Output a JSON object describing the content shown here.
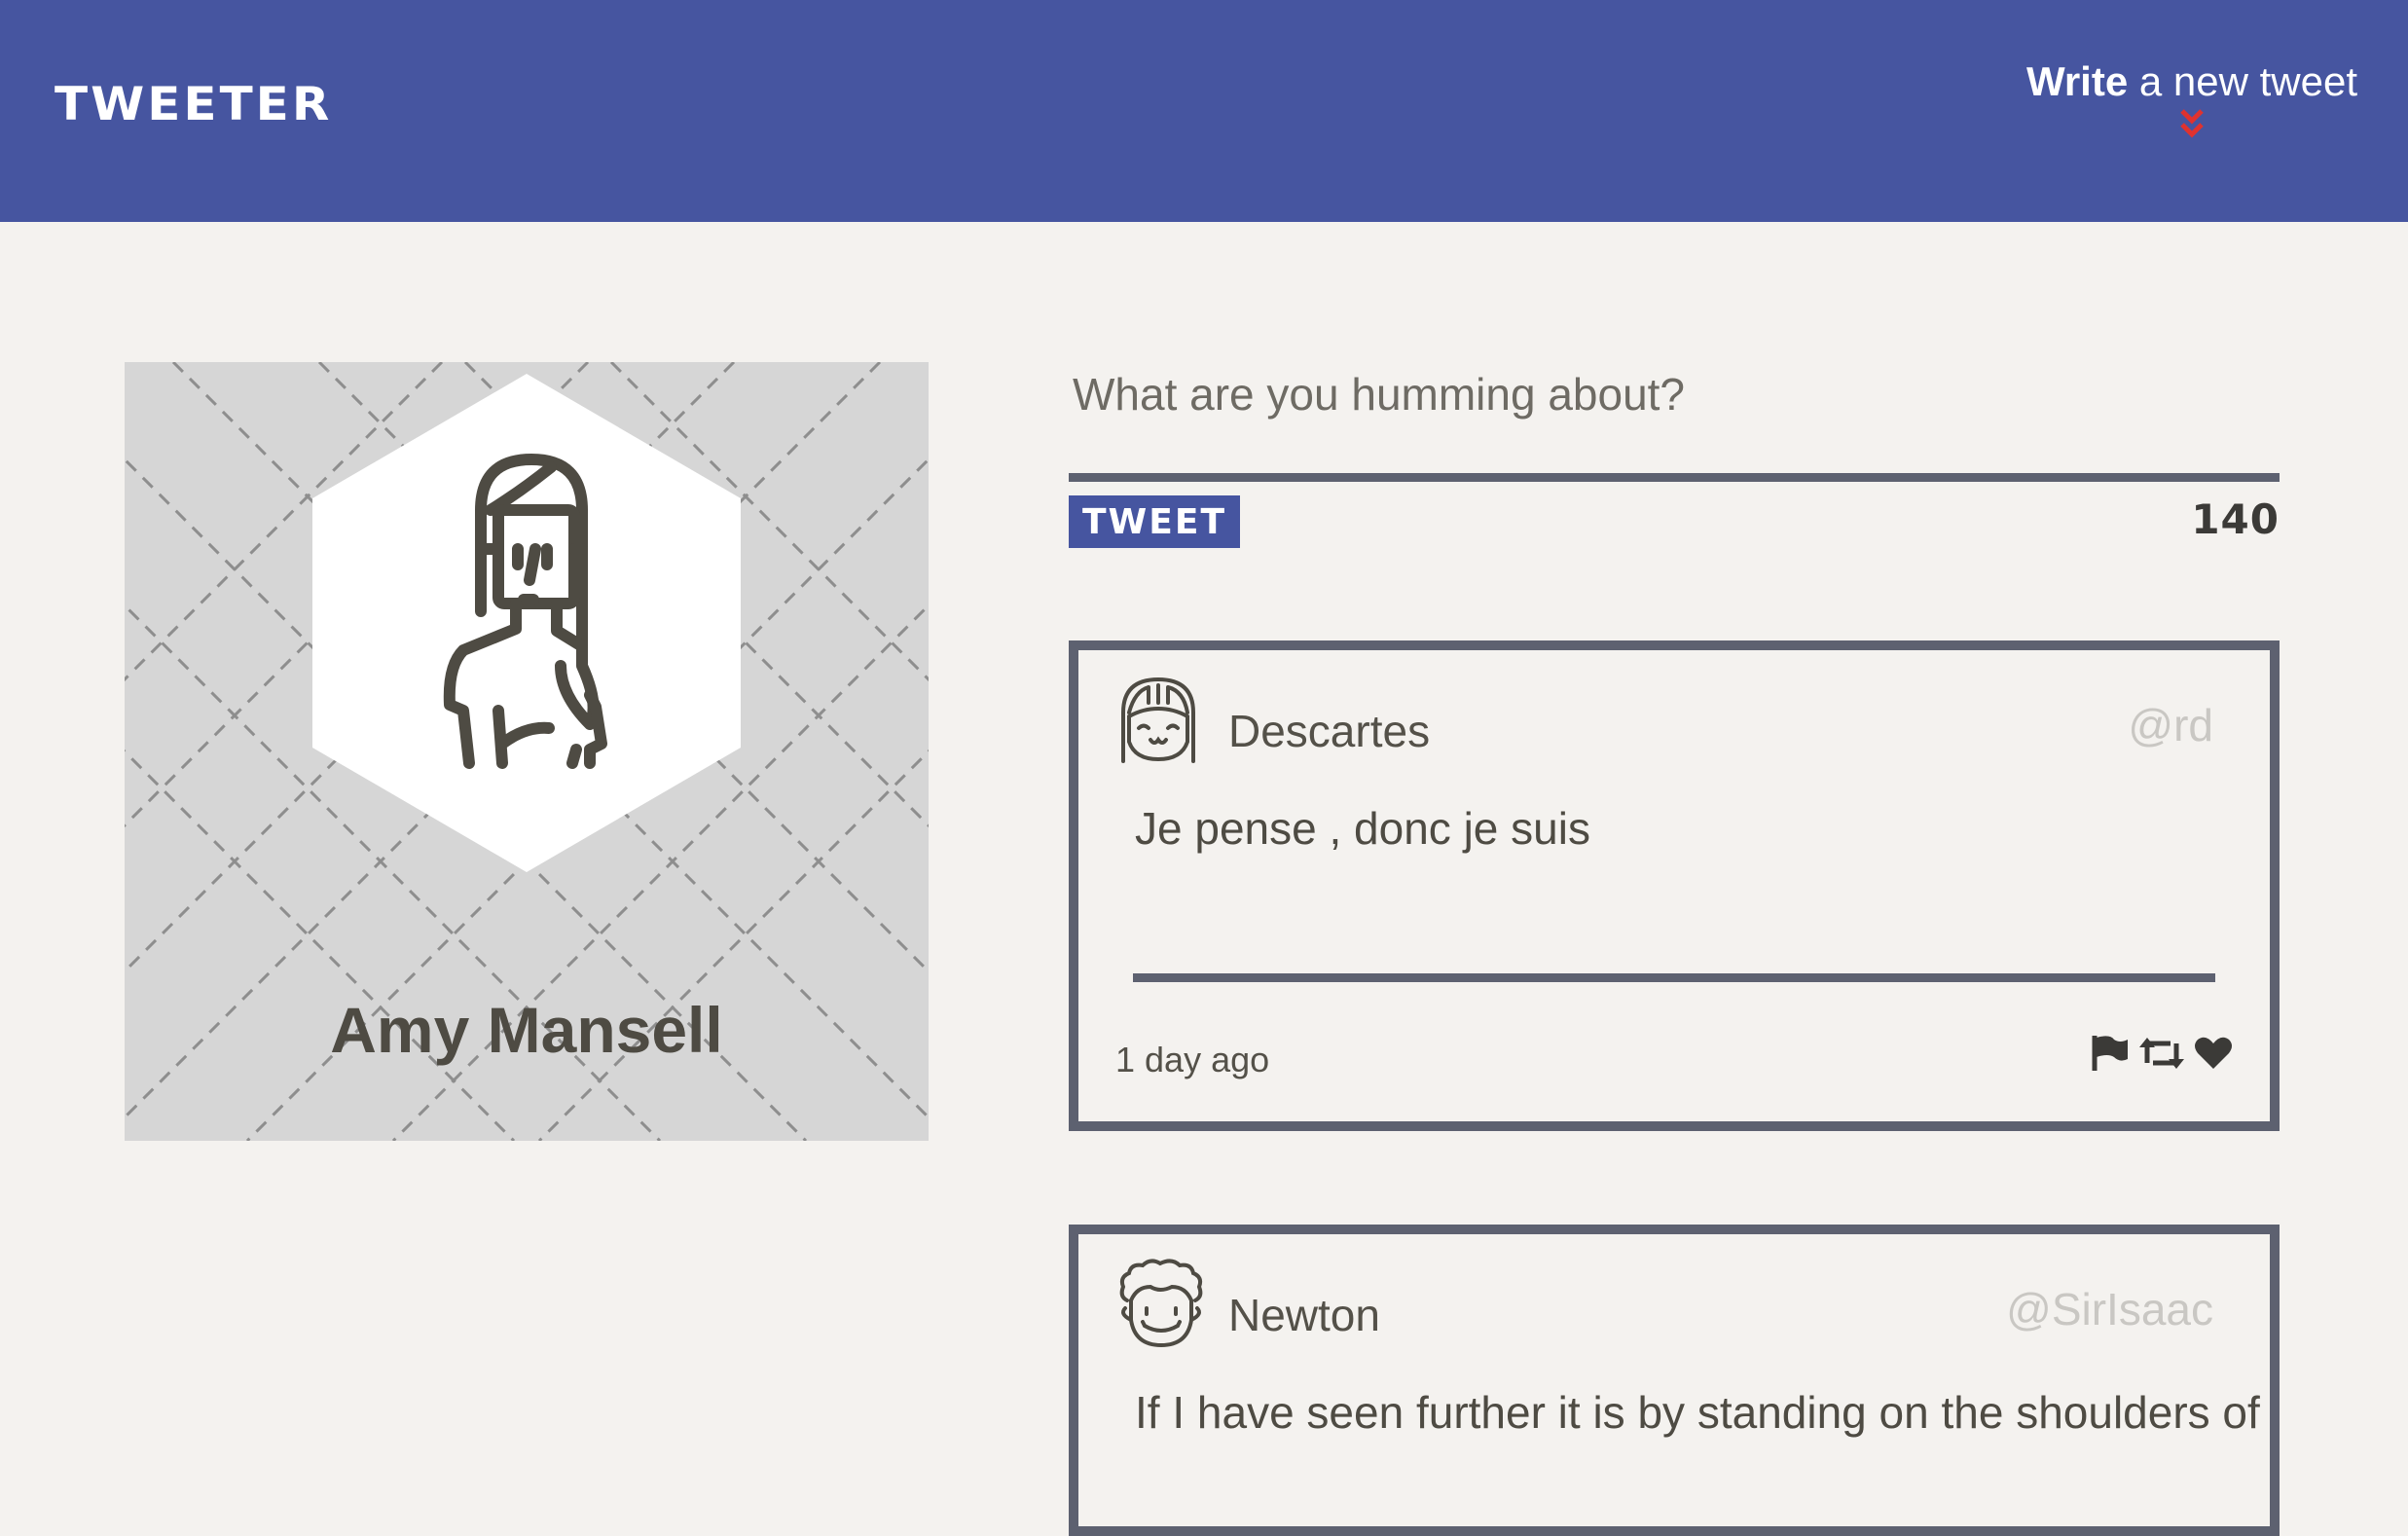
{
  "nav": {
    "brand": "TWEETER",
    "compose_toggle": {
      "strong": "Write",
      "rest": " a new tweet"
    }
  },
  "profile": {
    "name": "Amy Mansell",
    "avatar_icon": "woman-avatar-icon"
  },
  "compose": {
    "placeholder": "What are you humming about?",
    "button_label": "TWEET",
    "counter": "140"
  },
  "tweets": [
    {
      "author": "Descartes",
      "handle": "@rd",
      "body": "Je pense , donc je suis",
      "time": "1 day ago",
      "avatar_icon": "smiling-face-avatar-icon",
      "actions": [
        "flag-icon",
        "retweet-icon",
        "heart-icon"
      ]
    },
    {
      "author": "Newton",
      "handle": "@SirIsaac",
      "body": "If I have seen further it is by standing on the shoulders of",
      "avatar_icon": "curly-hair-face-avatar-icon"
    }
  ],
  "colors": {
    "nav_bg": "#4655a0",
    "page_bg": "#f4f2ef",
    "border": "#5d6170",
    "accent_arrow": "#e0322f",
    "text": "#545149",
    "handle": "#c9c7c3"
  }
}
